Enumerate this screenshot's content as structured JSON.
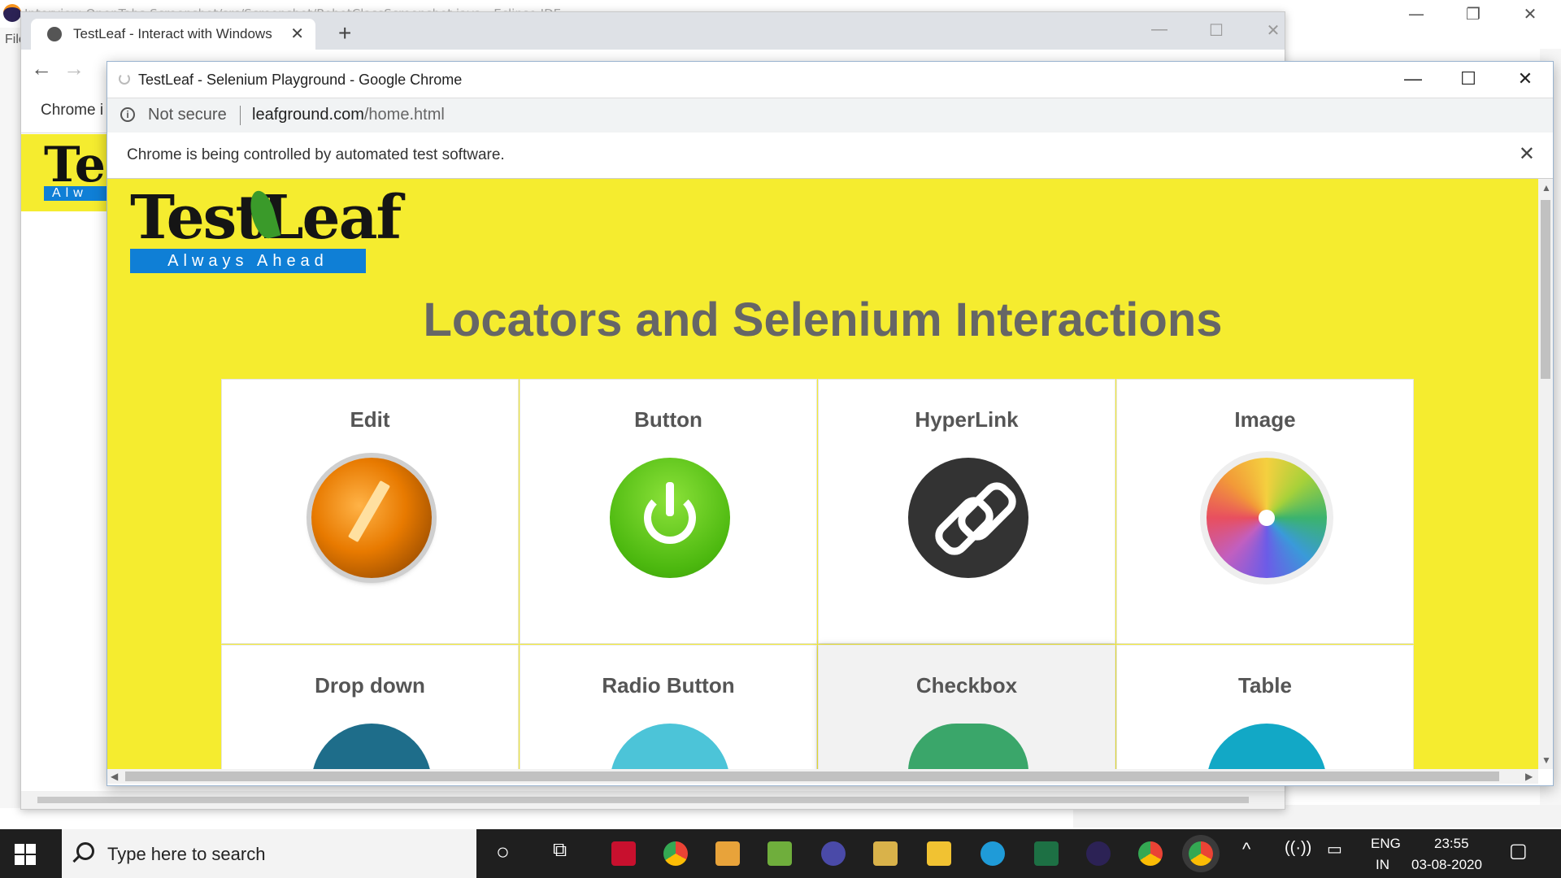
{
  "background_window": {
    "title": "Interview-OpenTabs-Screenshot/src/Screenshot/RobotClassScreenshot.java - Eclipse IDE",
    "menu_first": "File",
    "controls": [
      "—",
      "❐",
      "✕"
    ]
  },
  "chrome_back": {
    "tab_title": "TestLeaf - Interact with Windows",
    "tab_close": "✕",
    "new_tab": "+",
    "infobar_text": "Chrome i",
    "controls": [
      "—",
      "☐",
      "✕"
    ],
    "logo_text": "Tes",
    "logo_band": "Alw"
  },
  "chrome_front": {
    "window_title": "TestLeaf - Selenium Playground - Google Chrome",
    "controls": [
      "—",
      "☐",
      "✕"
    ],
    "security_label": "Not secure",
    "url_host": "leafground.com",
    "url_path": "/home.html",
    "automation_notice": "Chrome is being controlled by automated test software.",
    "notice_close": "✕"
  },
  "page": {
    "logo_text": "TestLeaf",
    "logo_tagline": "Always Ahead",
    "heading": "Locators and Selenium Interactions",
    "cards": [
      {
        "label": "Edit",
        "icon": "edit-pencil-icon"
      },
      {
        "label": "Button",
        "icon": "power-button-icon"
      },
      {
        "label": "HyperLink",
        "icon": "chain-link-icon"
      },
      {
        "label": "Image",
        "icon": "photos-flower-icon"
      },
      {
        "label": "Drop down",
        "icon": "dropdown-icon"
      },
      {
        "label": "Radio Button",
        "icon": "radio-icon"
      },
      {
        "label": "Checkbox",
        "icon": "checkbox-icon"
      },
      {
        "label": "Table",
        "icon": "table-icon"
      }
    ]
  },
  "taskbar": {
    "search_placeholder": "Type here to search",
    "language": "ENG",
    "region": "IN",
    "time": "23:55",
    "date": "03-08-2020"
  }
}
